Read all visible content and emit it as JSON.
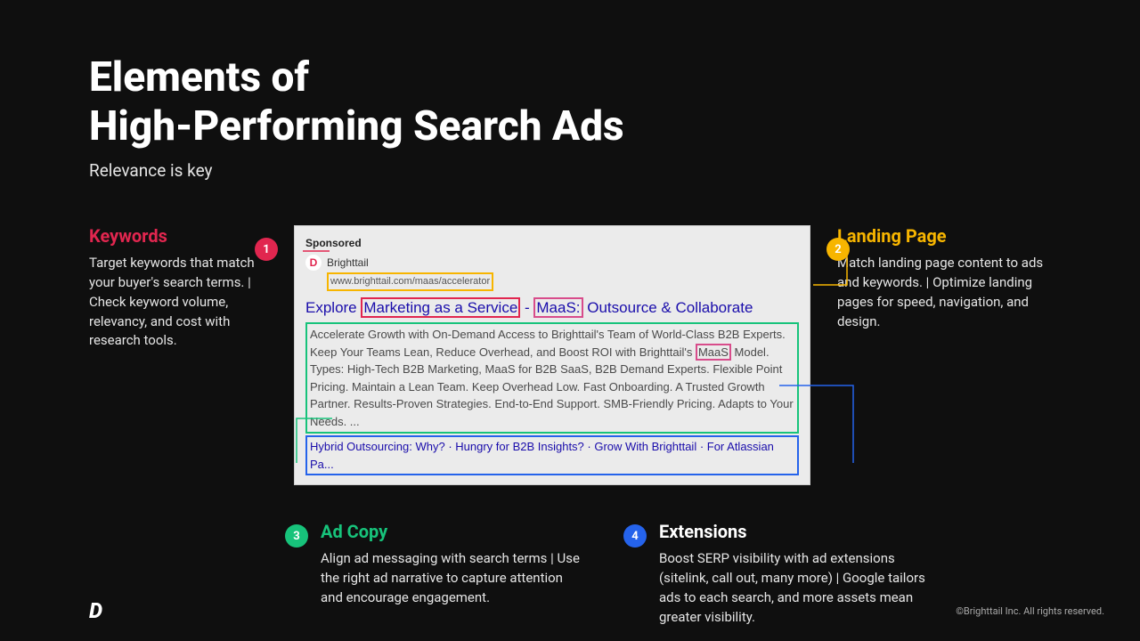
{
  "title_line1": "Elements of",
  "title_line2": "High-Performing Search Ads",
  "subtitle": "Relevance is key",
  "callouts": {
    "keywords": {
      "num": "1",
      "heading": "Keywords",
      "body": "Target keywords that match your buyer's search terms. | Check keyword volume, relevancy, and cost with research tools."
    },
    "landing": {
      "num": "2",
      "heading": "Landing Page",
      "body": "Match landing page content to ads and keywords. | Optimize landing pages for speed, navigation, and design."
    },
    "adcopy": {
      "num": "3",
      "heading": "Ad Copy",
      "body": "Align ad messaging with search terms | Use the right ad narrative to capture attention and encourage engagement."
    },
    "extensions": {
      "num": "4",
      "heading": "Extensions",
      "body": "Boost SERP visibility with ad extensions (sitelink, call out, many more) |  Google tailors ads to each search, and more assets mean greater visibility."
    }
  },
  "ad": {
    "sponsored": "Sponsored",
    "brand": "Brighttail",
    "url": "www.brighttail.com/maas/accelerator",
    "headline_pre": "Explore ",
    "headline_kw1": "Marketing as a Service",
    "headline_sep": " - ",
    "headline_kw2": "MaaS:",
    "headline_post": " Outsource & Collaborate",
    "desc1": "Accelerate Growth with On-Demand Access to Brighttail's Team of World-Class B2B Experts. Keep Your Teams Lean, Reduce Overhead, and Boost ROI with Brighttail's ",
    "desc1_kw": "MaaS",
    "desc1_post": " Model. Types: High-Tech B2B Marketing, MaaS for B2B SaaS, B2B Demand Experts. Flexible Point Pricing. Maintain a Lean Team. Keep Overhead Low. Fast Onboarding. A Trusted Growth Partner. Results-Proven Strategies. End-to-End Support. SMB-Friendly Pricing. Adapts to Your Needs. ...",
    "links": "Hybrid Outsourcing: Why? · Hungry for B2B Insights? · Grow With Brighttail · For Atlassian Pa..."
  },
  "footer": {
    "logo": "D",
    "copy": "©Brighttail Inc. All rights reserved."
  }
}
